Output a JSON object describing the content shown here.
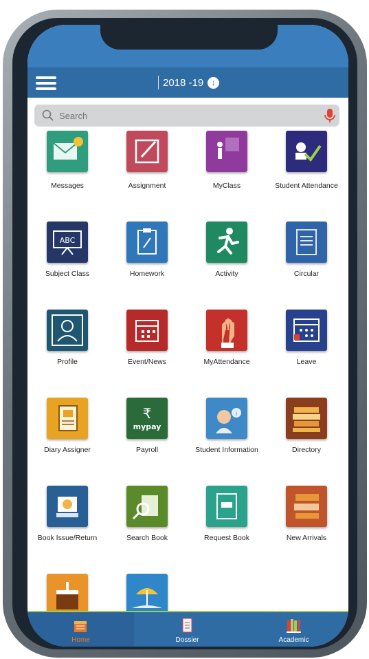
{
  "header": {
    "academic_year": "2018 -19",
    "year_dropdown_icon": "chevron-down-circle-icon",
    "menu_icon": "hamburger-menu-icon"
  },
  "search": {
    "placeholder": "Search",
    "search_icon": "magnifier-icon",
    "mic_icon": "microphone-icon",
    "mic_color": "#e2412f"
  },
  "modules": [
    {
      "label": "Messages",
      "icon": "messages-icon",
      "color": "#2f9d7e"
    },
    {
      "label": "Assignment",
      "icon": "assignment-icon",
      "color": "#c04a5b"
    },
    {
      "label": "MyClass",
      "icon": "myclass-icon",
      "color": "#8f3a9c"
    },
    {
      "label": "Student Attendance",
      "icon": "student-attendance-icon",
      "color": "#2d2b7b"
    },
    {
      "label": "Subject Class",
      "icon": "subject-class-icon",
      "color": "#243766"
    },
    {
      "label": "Homework",
      "icon": "homework-icon",
      "color": "#2f77b8"
    },
    {
      "label": "Activity",
      "icon": "activity-icon",
      "color": "#1f8a62"
    },
    {
      "label": "Circular",
      "icon": "circular-icon",
      "color": "#2f64a8"
    },
    {
      "label": "Profile",
      "icon": "profile-icon",
      "color": "#1f5672"
    },
    {
      "label": "Event/News",
      "icon": "event-news-icon",
      "color": "#b62a2a"
    },
    {
      "label": "MyAttendance",
      "icon": "my-attendance-icon",
      "color": "#c4302a"
    },
    {
      "label": "Leave",
      "icon": "leave-icon",
      "color": "#27418c"
    },
    {
      "label": "Diary Assigner",
      "icon": "diary-assigner-icon",
      "color": "#e8a322"
    },
    {
      "label": "Payroll",
      "icon": "payroll-icon",
      "color": "#2b6b3a"
    },
    {
      "label": "Student Information",
      "icon": "student-information-icon",
      "color": "#3f89c6"
    },
    {
      "label": "Directory",
      "icon": "directory-icon",
      "color": "#8a3e1e"
    },
    {
      "label": "Book Issue/Return",
      "icon": "book-issue-return-icon",
      "color": "#285f95"
    },
    {
      "label": "Search Book",
      "icon": "search-book-icon",
      "color": "#5a8a2a"
    },
    {
      "label": "Request Book",
      "icon": "request-book-icon",
      "color": "#2ba28c"
    },
    {
      "label": "New Arrivals",
      "icon": "new-arrivals-icon",
      "color": "#c0542b"
    },
    {
      "label": "",
      "icon": "birthday-icon",
      "color": "#e8942a"
    },
    {
      "label": "",
      "icon": "holiday-icon",
      "color": "#2f86c8"
    }
  ],
  "payroll_tile_text": {
    "rupee": "₹",
    "brand": "mypay"
  },
  "tabs": [
    {
      "label": "Home",
      "icon": "home-icon",
      "active": true,
      "label_color": "#e57a2b"
    },
    {
      "label": "Dossier",
      "icon": "dossier-icon",
      "active": false
    },
    {
      "label": "Academic",
      "icon": "academic-books-icon",
      "active": false
    }
  ],
  "colors": {
    "header_blue": "#2f6ca4",
    "status_blue": "#3a7ebd",
    "tab_accent": "#9ad24b"
  }
}
